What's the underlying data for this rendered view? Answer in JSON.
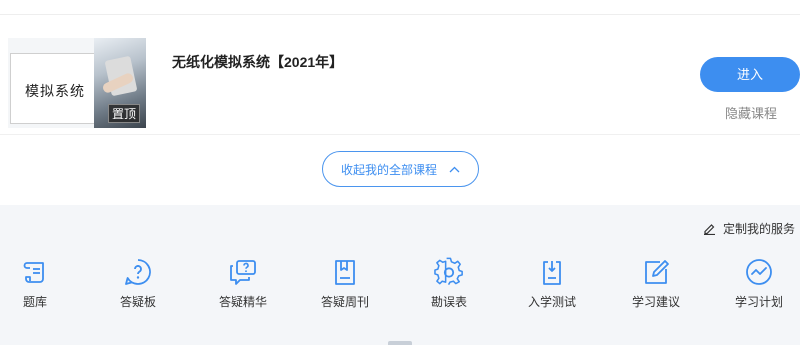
{
  "course": {
    "thumbnail_text": "模拟系统",
    "pin_label": "置顶",
    "title": "无纸化模拟系统【2021年】",
    "enter_label": "进入",
    "hide_label": "隐藏课程"
  },
  "collapse": {
    "label": "收起我的全部课程",
    "icon": "chevron-up-icon"
  },
  "services": {
    "customize_label": "定制我的服务",
    "customize_icon": "pencil-icon",
    "accent_color": "#3d8ef0",
    "items": [
      {
        "label": "题库",
        "icon": "scroll-icon"
      },
      {
        "label": "答疑板",
        "icon": "question-bubble-icon"
      },
      {
        "label": "答疑精华",
        "icon": "chat-question-icon"
      },
      {
        "label": "答疑周刊",
        "icon": "bookmark-book-icon"
      },
      {
        "label": "勘误表",
        "icon": "gear-icon"
      },
      {
        "label": "入学测试",
        "icon": "test-paper-icon"
      },
      {
        "label": "学习建议",
        "icon": "edit-square-icon"
      },
      {
        "label": "学习计划",
        "icon": "trend-circle-icon"
      }
    ]
  }
}
